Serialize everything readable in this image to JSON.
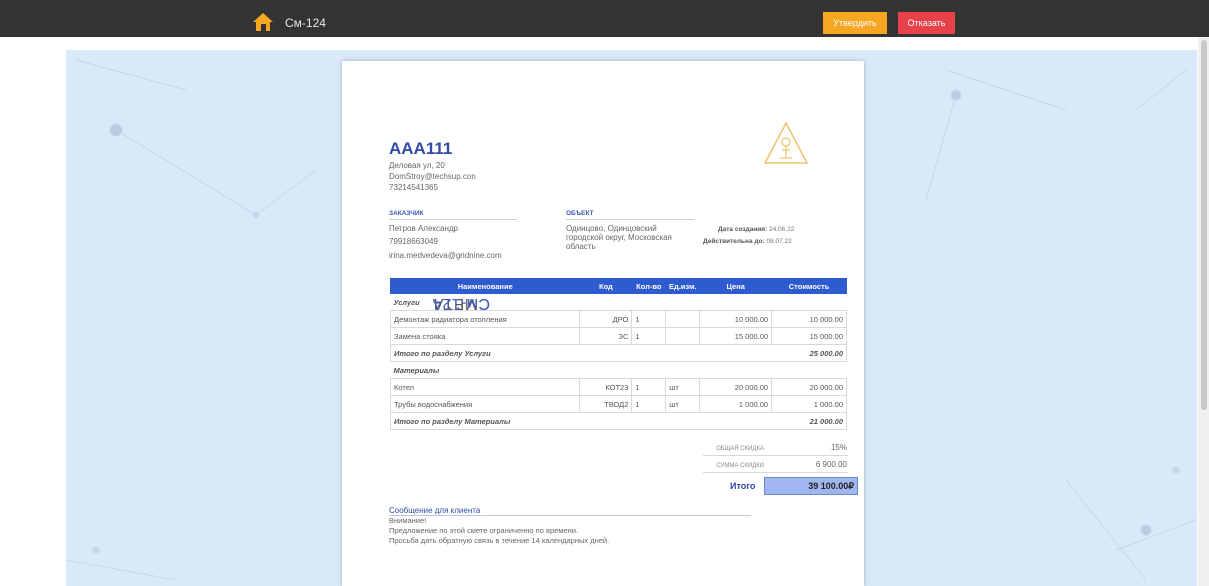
{
  "header": {
    "title": "См-124",
    "approve_label": "Утвердить",
    "reject_label": "Отказать",
    "colors": {
      "bar": "#333333",
      "approve": "#f5a623",
      "reject": "#e8414a"
    }
  },
  "document": {
    "side_title_prefix": "СМЕТА",
    "side_title_number": "См-124",
    "company": {
      "name": "AAA111",
      "address": "Деловая ул, 20",
      "email": "DomStroy@techsup.con",
      "phone": "73214541365"
    },
    "customer": {
      "label": "ЗАКАЗЧИК",
      "name": "Петров Александр",
      "phone": "79918663049",
      "email": "irina.medvedeva@gridnine.com"
    },
    "object": {
      "label": "ОБЪЕКТ",
      "line1": "Одинцово, Одинцовский",
      "line2": "городской округ, Московская",
      "line3": "область"
    },
    "dates": {
      "created_label": "Дата создания:",
      "created_value": "24.06.22",
      "valid_label": "Действительна до:",
      "valid_value": "08.07.22"
    },
    "table": {
      "headers": [
        "Наименование",
        "Код",
        "Кол-во",
        "Ед.изм.",
        "Цена",
        "Стоимость"
      ],
      "sections": [
        {
          "title": "Услуги",
          "rows": [
            [
              "Демонтаж радиатора отопления",
              "ДРО",
              "1",
              "",
              "10 000.00",
              "10 000.00"
            ],
            [
              "Замена стояка",
              "ЗС",
              "1",
              "",
              "15 000.00",
              "15 000.00"
            ]
          ],
          "subtotal_label": "Итого по разделу Услуги",
          "subtotal_value": "25 000.00"
        },
        {
          "title": "Материалы",
          "rows": [
            [
              "Котел",
              "КОТ23",
              "1",
              "шт",
              "20 000.00",
              "20 000.00"
            ],
            [
              "Трубы водоснабжения",
              "ТВОД2",
              "1",
              "шт",
              "1 000.00",
              "1 000.00"
            ]
          ],
          "subtotal_label": "Итого по разделу Материалы",
          "subtotal_value": "21 000.00"
        }
      ]
    },
    "summary": {
      "discount_label": "ОБЩАЯ СКИДКА",
      "discount_value": "15%",
      "discount_sum_label": "СУММА СКИДКИ",
      "discount_sum_value": "6 900.00",
      "total_label": "Итого",
      "total_value": "39 100.00₽"
    },
    "message": {
      "title": "Сообщение для клиента",
      "line1": "Внимание!",
      "line2": "Предложение по этой смете ограниченно по времени.",
      "line3": "Просьба дать обратную связь в течение 14 календарных дней."
    }
  }
}
